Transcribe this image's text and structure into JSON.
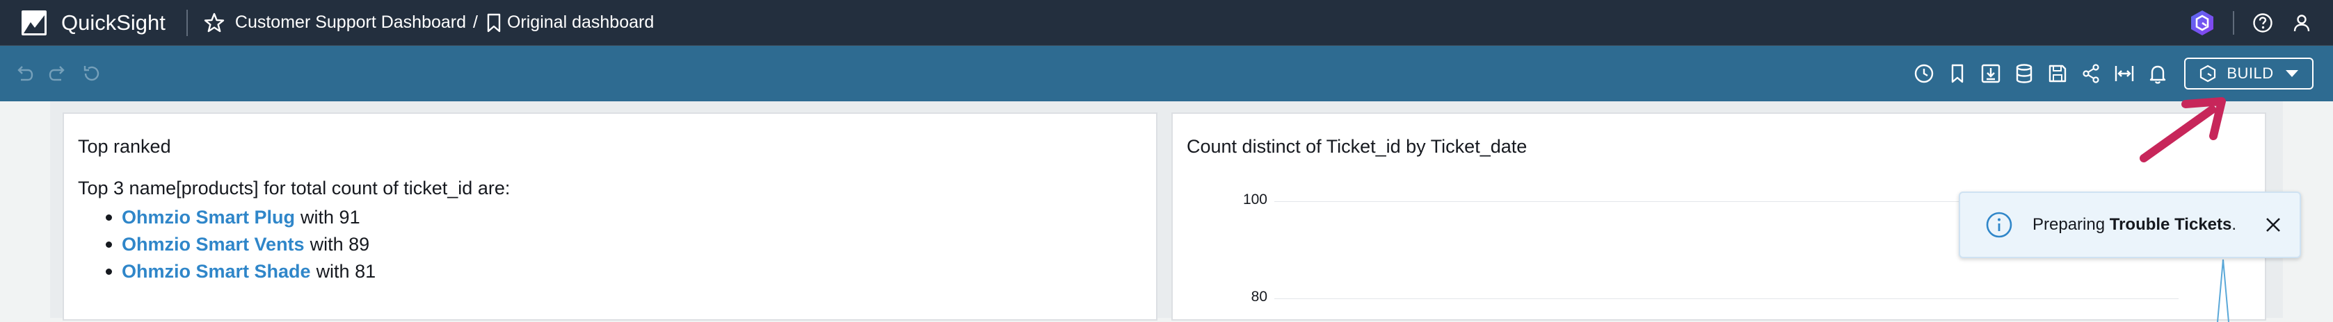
{
  "app": {
    "name": "QuickSight"
  },
  "breadcrumb": {
    "dashboard": "Customer Support Dashboard",
    "separator": "/",
    "sheet": "Original dashboard"
  },
  "toolbar": {
    "build_label": "BUILD"
  },
  "visual1": {
    "title": "Top ranked",
    "narrative": "Top 3 name[products] for total count of ticket_id are:",
    "items": [
      {
        "name": "Ohmzio Smart Plug",
        "suffix": "with 91"
      },
      {
        "name": "Ohmzio Smart Vents",
        "suffix": "with 89"
      },
      {
        "name": "Ohmzio Smart Shade",
        "suffix": "with 81"
      }
    ]
  },
  "visual2": {
    "title": "Count distinct of Ticket_id by Ticket_date",
    "y_ticks": [
      "100",
      "80"
    ]
  },
  "toast": {
    "prefix": "Preparing",
    "bold": "Trouble Tickets",
    "suffix": "."
  },
  "colors": {
    "header": "#232f3e",
    "toolbar": "#2e6b91",
    "link": "#2f86c9",
    "toast_bg": "#ebf4fb",
    "arrow": "#c7265a"
  }
}
